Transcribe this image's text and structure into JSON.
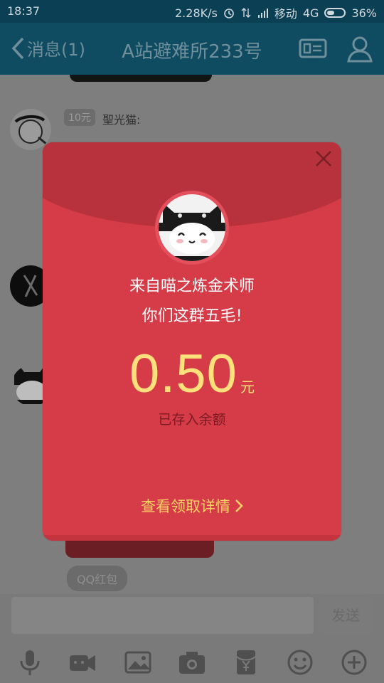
{
  "status_bar": {
    "time": "18:37",
    "speed": "2.28K/s",
    "carrier": "移动",
    "network": "4G",
    "battery": "36%"
  },
  "title_bar": {
    "back_label": "消息(1)",
    "title": "A站避难所233号"
  },
  "chat": {
    "message": {
      "tag": "10元",
      "sender": "聖光猫:"
    },
    "qq_hongbao_label": "QQ红包",
    "send_label": "发送"
  },
  "packet": {
    "from": "来自喵之炼金术师",
    "message": "你们这群五毛!",
    "amount": "0.50",
    "unit": "元",
    "saved": "已存入余额",
    "detail_link": "查看领取详情"
  },
  "colors": {
    "packet_red": "#d63b48",
    "amount_yellow": "#ffe07a",
    "header_blue": "#0f4b61"
  },
  "icons": {
    "toolbar": [
      "microphone-icon",
      "video-icon",
      "image-icon",
      "camera-icon",
      "red-packet-icon",
      "emoji-icon",
      "plus-icon"
    ]
  }
}
